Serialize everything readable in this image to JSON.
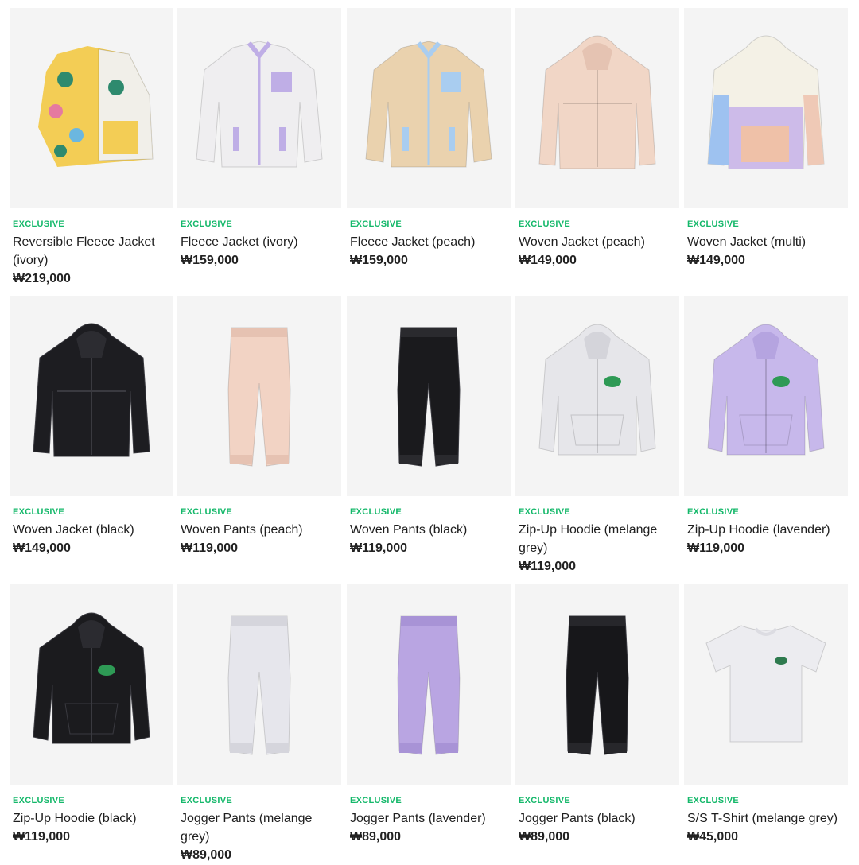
{
  "products": [
    {
      "badge": "EXCLUSIVE",
      "name": "Reversible Fleece Jacket (ivory)",
      "price": "₩219,000",
      "icon": "fleece-jacket-icon",
      "kind": "jacket-rev",
      "color": "#f1efe9",
      "accent": "#f3cd55"
    },
    {
      "badge": "EXCLUSIVE",
      "name": "Fleece Jacket (ivory)",
      "price": "₩159,000",
      "icon": "fleece-jacket-icon",
      "kind": "fleece",
      "color": "#efeef0",
      "accent": "#bfaee6"
    },
    {
      "badge": "EXCLUSIVE",
      "name": "Fleece Jacket (peach)",
      "price": "₩159,000",
      "icon": "fleece-jacket-icon",
      "kind": "fleece",
      "color": "#ead2ae",
      "accent": "#a9cdf0"
    },
    {
      "badge": "EXCLUSIVE",
      "name": "Woven Jacket (peach)",
      "price": "₩149,000",
      "icon": "woven-jacket-icon",
      "kind": "hood",
      "color": "#f1d6c6",
      "accent": "#e5c3b2"
    },
    {
      "badge": "EXCLUSIVE",
      "name": "Woven Jacket (multi)",
      "price": "₩149,000",
      "icon": "woven-jacket-icon",
      "kind": "multi",
      "color": "#f4f1e6",
      "accent": "#cdbbe9"
    },
    {
      "badge": "EXCLUSIVE",
      "name": "Woven Jacket (black)",
      "price": "₩149,000",
      "icon": "woven-jacket-icon",
      "kind": "hood",
      "color": "#1d1d21",
      "accent": "#2c2c31"
    },
    {
      "badge": "EXCLUSIVE",
      "name": "Woven Pants (peach)",
      "price": "₩119,000",
      "icon": "pants-icon",
      "kind": "pants",
      "color": "#f2d3c4",
      "accent": "#e6c2b2"
    },
    {
      "badge": "EXCLUSIVE",
      "name": "Woven Pants (black)",
      "price": "₩119,000",
      "icon": "pants-icon",
      "kind": "pants",
      "color": "#1a1a1d",
      "accent": "#2a2a2e"
    },
    {
      "badge": "EXCLUSIVE",
      "name": "Zip-Up Hoodie (melange grey)",
      "price": "₩119,000",
      "icon": "hoodie-icon",
      "kind": "hoodie",
      "color": "#e6e6ea",
      "accent": "#d4d4da"
    },
    {
      "badge": "EXCLUSIVE",
      "name": "Zip-Up Hoodie (lavender)",
      "price": "₩119,000",
      "icon": "hoodie-icon",
      "kind": "hoodie",
      "color": "#c7b8eb",
      "accent": "#b5a4e0"
    },
    {
      "badge": "EXCLUSIVE",
      "name": "Zip-Up Hoodie (black)",
      "price": "₩119,000",
      "icon": "hoodie-icon",
      "kind": "hoodie",
      "color": "#1b1b1e",
      "accent": "#2b2b30"
    },
    {
      "badge": "EXCLUSIVE",
      "name": "Jogger Pants (melange grey)",
      "price": "₩89,000",
      "icon": "pants-icon",
      "kind": "pants",
      "color": "#e6e6ec",
      "accent": "#d5d5dc"
    },
    {
      "badge": "EXCLUSIVE",
      "name": "Jogger Pants (lavender)",
      "price": "₩89,000",
      "icon": "pants-icon",
      "kind": "pants",
      "color": "#b9a5e2",
      "accent": "#a893d6"
    },
    {
      "badge": "EXCLUSIVE",
      "name": "Jogger Pants (black)",
      "price": "₩89,000",
      "icon": "pants-icon",
      "kind": "pants",
      "color": "#17171a",
      "accent": "#27272b"
    },
    {
      "badge": "EXCLUSIVE",
      "name": "S/S T-Shirt (melange grey)",
      "price": "₩45,000",
      "icon": "tshirt-icon",
      "kind": "tee",
      "color": "#ececf0",
      "accent": "#dcdce2"
    }
  ]
}
